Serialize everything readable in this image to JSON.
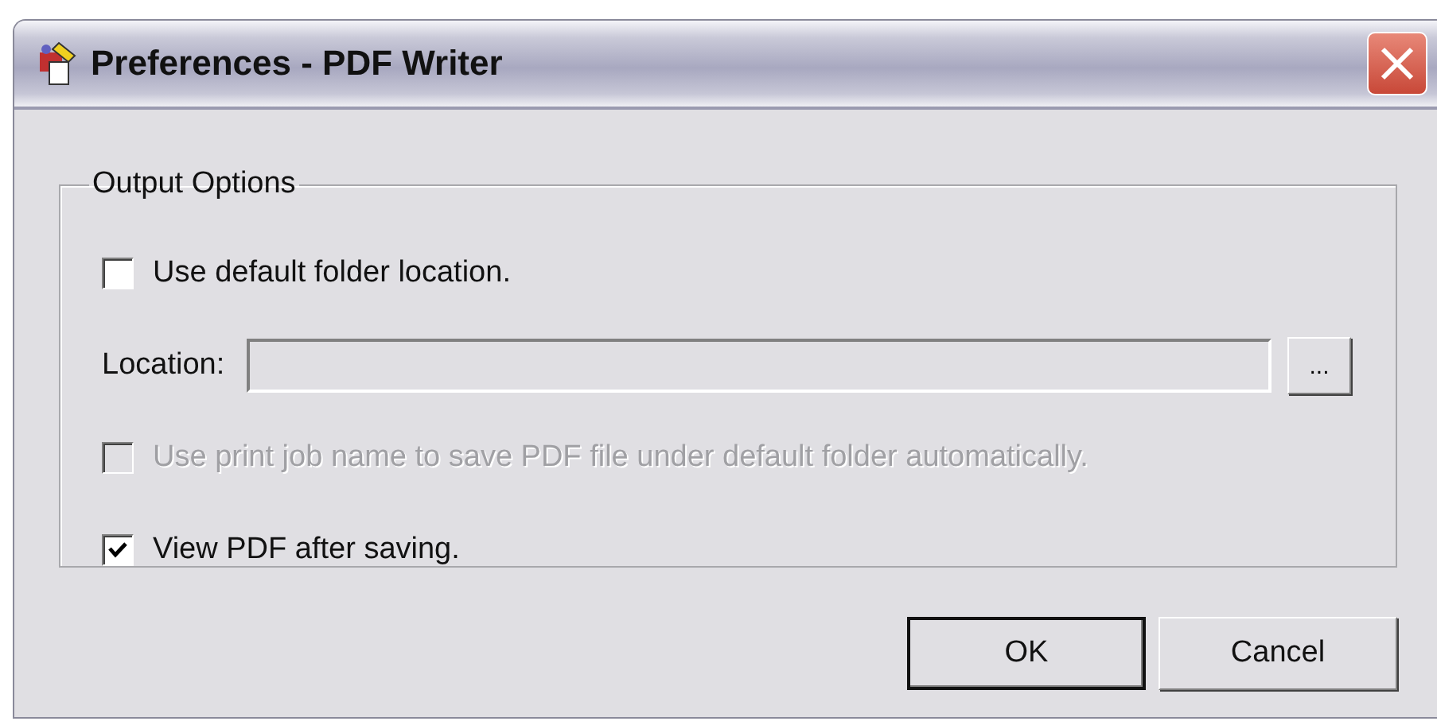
{
  "window": {
    "title": "Preferences - PDF Writer"
  },
  "group": {
    "title": "Output Options",
    "items": [
      {
        "kind": "checkbox",
        "label": "Use default folder location.",
        "checked": false,
        "disabled": false
      },
      {
        "kind": "path",
        "label": "Location:",
        "disabled": true,
        "browse": "..."
      },
      {
        "kind": "checkbox",
        "label": "Use print job name to save PDF file under default folder automatically.",
        "checked": false,
        "disabled": true
      },
      {
        "kind": "checkbox",
        "label": "View PDF after saving.",
        "checked": true,
        "disabled": false
      }
    ]
  },
  "buttons": [
    {
      "label": "OK",
      "default": true
    },
    {
      "label": "Cancel",
      "default": false
    }
  ]
}
